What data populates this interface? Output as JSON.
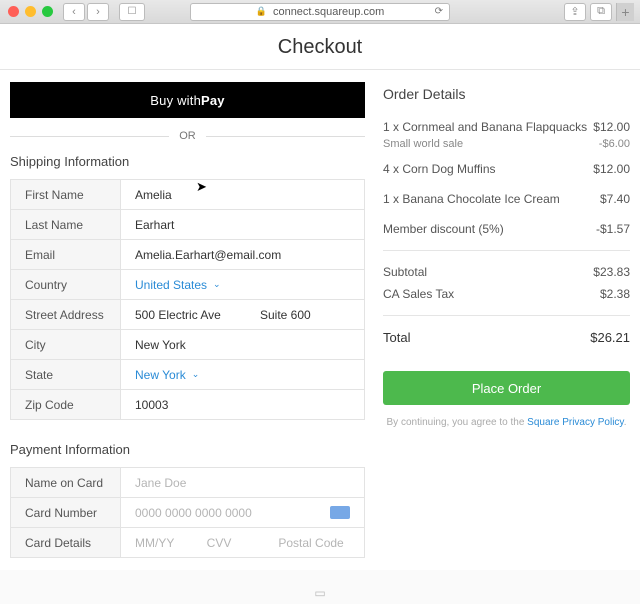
{
  "browser": {
    "url": "connect.squareup.com"
  },
  "page": {
    "title": "Checkout",
    "applePay": {
      "prefix": "Buy with ",
      "brand": "Pay"
    },
    "orLabel": "OR",
    "shipping": {
      "title": "Shipping Information",
      "firstName": {
        "label": "First Name",
        "value": "Amelia"
      },
      "lastName": {
        "label": "Last Name",
        "value": "Earhart"
      },
      "email": {
        "label": "Email",
        "value": "Amelia.Earhart@email.com"
      },
      "country": {
        "label": "Country",
        "value": "United States"
      },
      "street": {
        "label": "Street Address",
        "value": "500 Electric Ave",
        "value2": "Suite 600"
      },
      "city": {
        "label": "City",
        "value": "New York"
      },
      "state": {
        "label": "State",
        "value": "New York"
      },
      "zip": {
        "label": "Zip Code",
        "value": "10003"
      }
    },
    "payment": {
      "title": "Payment Information",
      "nameOnCard": {
        "label": "Name on Card",
        "placeholder": "Jane Doe"
      },
      "cardNumber": {
        "label": "Card Number",
        "placeholder": "0000 0000 0000 0000"
      },
      "cardDetails": {
        "label": "Card Details",
        "expPlaceholder": "MM/YY",
        "cvvPlaceholder": "CVV",
        "zipPlaceholder": "Postal Code"
      }
    },
    "order": {
      "title": "Order Details",
      "items": [
        {
          "label": "1 x Cornmeal and Banana Flapquacks",
          "price": "$12.00",
          "sublabel": "Small world sale",
          "subprice": "-$6.00"
        },
        {
          "label": "4 x Corn Dog Muffins",
          "price": "$12.00"
        },
        {
          "label": "1 x Banana Chocolate Ice Cream",
          "price": "$7.40"
        },
        {
          "label": "Member discount (5%)",
          "price": "-$1.57"
        }
      ],
      "subtotalLabel": "Subtotal",
      "subtotal": "$23.83",
      "taxLabel": "CA Sales Tax",
      "tax": "$2.38",
      "totalLabel": "Total",
      "total": "$26.21",
      "placeOrderLabel": "Place Order",
      "disclaimerPrefix": "By continuing, you agree to the ",
      "disclaimerLink": "Square Privacy Policy"
    }
  }
}
